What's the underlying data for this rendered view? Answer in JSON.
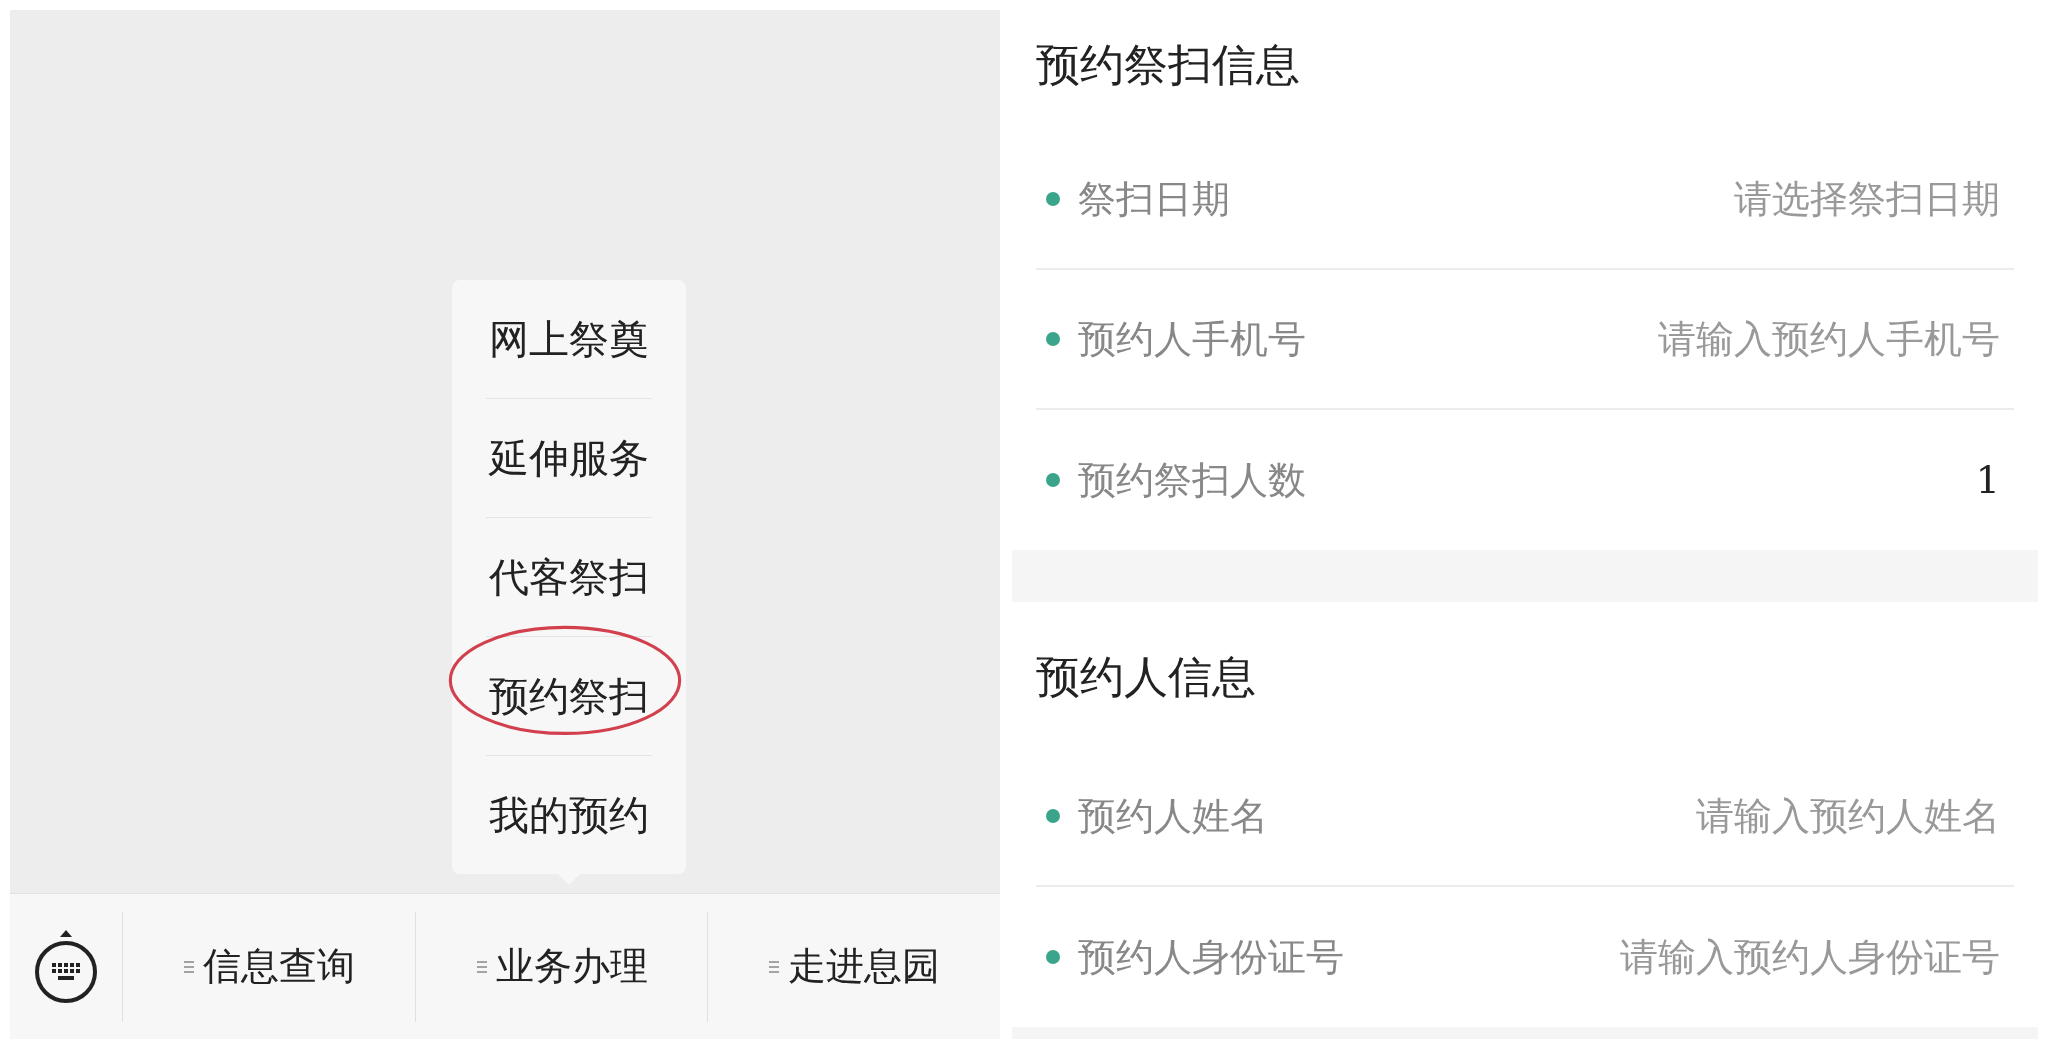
{
  "menu": {
    "items": [
      {
        "label": "网上祭奠",
        "circled": false
      },
      {
        "label": "延伸服务",
        "circled": false
      },
      {
        "label": "代客祭扫",
        "circled": false
      },
      {
        "label": "预约祭扫",
        "circled": true
      },
      {
        "label": "我的预约",
        "circled": false
      }
    ]
  },
  "bottom_bar": {
    "tabs": [
      {
        "label": "信息查询"
      },
      {
        "label": "业务办理"
      },
      {
        "label": "走进息园"
      }
    ]
  },
  "sections": [
    {
      "title": "预约祭扫信息",
      "rows": [
        {
          "label": "祭扫日期",
          "placeholder": "请选择祭扫日期"
        },
        {
          "label": "预约人手机号",
          "placeholder": "请输入预约人手机号"
        },
        {
          "label": "预约祭扫人数",
          "value": "1"
        }
      ]
    },
    {
      "title": "预约人信息",
      "rows": [
        {
          "label": "预约人姓名",
          "placeholder": "请输入预约人姓名"
        },
        {
          "label": "预约人身份证号",
          "placeholder": "请输入预约人身份证号"
        }
      ]
    }
  ]
}
